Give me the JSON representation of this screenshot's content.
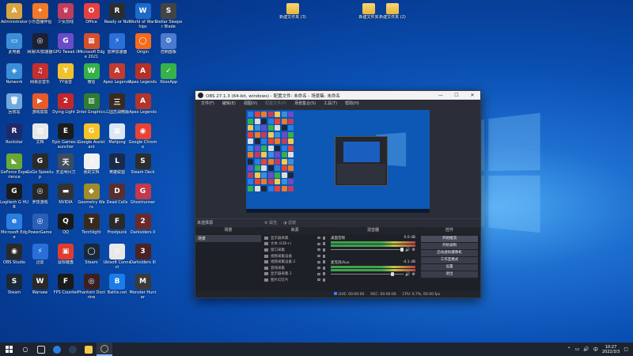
{
  "desktop": {
    "icons": [
      {
        "label": "Administrator",
        "col": 0,
        "row": 0,
        "color": "#d9a440",
        "glyph": "A"
      },
      {
        "label": "小乐直播伴侣",
        "col": 1,
        "row": 0,
        "color": "#f07a27",
        "glyph": "✦"
      },
      {
        "label": "少女前线",
        "col": 2,
        "row": 0,
        "color": "#c23c5b",
        "glyph": "♛"
      },
      {
        "label": "Office",
        "col": 3,
        "row": 0,
        "color": "#e8403f",
        "glyph": "O"
      },
      {
        "label": "Ready or Not",
        "col": 4,
        "row": 0,
        "color": "#2d2d2d",
        "glyph": "R"
      },
      {
        "label": "World of Warships",
        "col": 5,
        "row": 0,
        "color": "#1d6ac8",
        "glyph": "W"
      },
      {
        "label": "Stellar Sleeper Blade",
        "col": 6,
        "row": 0,
        "color": "#444",
        "glyph": "S"
      },
      {
        "label": "此电脑",
        "col": 0,
        "row": 1,
        "color": "#3b8fd9",
        "glyph": "▭"
      },
      {
        "label": "网易UU加速器",
        "col": 1,
        "row": 1,
        "color": "#1c2033",
        "glyph": "◎"
      },
      {
        "label": "GPU Tweak II",
        "col": 2,
        "row": 1,
        "color": "#6a4bc9",
        "glyph": "G"
      },
      {
        "label": "Microsoft Edge 2021",
        "col": 3,
        "row": 1,
        "color": "#d64e2c",
        "glyph": "▦"
      },
      {
        "label": "雷神加速器",
        "col": 4,
        "row": 1,
        "color": "#2b6fd8",
        "glyph": "⚡"
      },
      {
        "label": "Origin",
        "col": 5,
        "row": 1,
        "color": "#f56b1b",
        "glyph": "◯"
      },
      {
        "label": "控制面板",
        "col": 6,
        "row": 1,
        "color": "#4a7bd0",
        "glyph": "⚙"
      },
      {
        "label": "Network",
        "col": 0,
        "row": 2,
        "color": "#3b8fd9",
        "glyph": "◈"
      },
      {
        "label": "网易云音乐",
        "col": 1,
        "row": 2,
        "color": "#c62f2f",
        "glyph": "♫"
      },
      {
        "label": "YY语音",
        "col": 2,
        "row": 2,
        "color": "#f2c12e",
        "glyph": "Y"
      },
      {
        "label": "微信",
        "col": 3,
        "row": 2,
        "color": "#35b245",
        "glyph": "W"
      },
      {
        "label": "Apex Legends",
        "col": 4,
        "row": 2,
        "color": "#c23b2f",
        "glyph": "A"
      },
      {
        "label": "Apex Legends",
        "col": 5,
        "row": 2,
        "color": "#b53127",
        "glyph": "A"
      },
      {
        "label": "XboxApp",
        "col": 6,
        "row": 2,
        "color": "#36b24a",
        "glyph": "✓"
      },
      {
        "label": "回收站",
        "col": 0,
        "row": 3,
        "color": "#6fa8dc",
        "glyph": "🗑"
      },
      {
        "label": "游戏加加",
        "col": 1,
        "row": 3,
        "color": "#e75a2a",
        "glyph": "▶"
      },
      {
        "label": "Dying Light 2",
        "col": 2,
        "row": 3,
        "color": "#c4262e",
        "glyph": "2"
      },
      {
        "label": "Intel Graphics",
        "col": 3,
        "row": 3,
        "color": "#2e7d32",
        "glyph": "▥"
      },
      {
        "label": "三国志战略版",
        "col": 4,
        "row": 3,
        "color": "#3a2a1e",
        "glyph": "三"
      },
      {
        "label": "Apex Legends",
        "col": 5,
        "row": 3,
        "color": "#b2342a",
        "glyph": "A"
      },
      {
        "label": "Rockstar",
        "col": 0,
        "row": 4,
        "color": "#1f2a6b",
        "glyph": "R"
      },
      {
        "label": "文档",
        "col": 1,
        "row": 4,
        "color": "#e8e8e8",
        "glyph": "▤"
      },
      {
        "label": "Epic Games Launcher",
        "col": 2,
        "row": 4,
        "color": "#1b1b1b",
        "glyph": "E"
      },
      {
        "label": "Google Assistant",
        "col": 3,
        "row": 4,
        "color": "#f7c325",
        "glyph": "G"
      },
      {
        "label": "Mahjong",
        "col": 4,
        "row": 4,
        "color": "#dde6f2",
        "glyph": "▦"
      },
      {
        "label": "Google Chrome",
        "col": 5,
        "row": 4,
        "color": "#e94235",
        "glyph": "◉"
      },
      {
        "label": "GeForce Experience",
        "col": 0,
        "row": 5,
        "color": "#6aa836",
        "glyph": "◣"
      },
      {
        "label": "GoGo Speedup",
        "col": 1,
        "row": 5,
        "color": "#2a2a2a",
        "glyph": "G"
      },
      {
        "label": "天涯明月刀",
        "col": 2,
        "row": 5,
        "color": "#3e4c5e",
        "glyph": "天"
      },
      {
        "label": "我的文档",
        "col": 3,
        "row": 5,
        "color": "#f2f2f2",
        "glyph": "▯"
      },
      {
        "label": "英雄联盟",
        "col": 4,
        "row": 5,
        "color": "#1c2a4a",
        "glyph": "L"
      },
      {
        "label": "Steam Deck",
        "col": 5,
        "row": 5,
        "color": "#2d2d2d",
        "glyph": "S"
      },
      {
        "label": "Logitech G HUB",
        "col": 0,
        "row": 6,
        "color": "#1b1b1b",
        "glyph": "G"
      },
      {
        "label": "罗技游戏",
        "col": 1,
        "row": 6,
        "color": "#262626",
        "glyph": "◎"
      },
      {
        "label": "NVIDIA",
        "col": 2,
        "row": 6,
        "color": "#333",
        "glyph": "▬"
      },
      {
        "label": "Geometry Wars",
        "col": 3,
        "row": 6,
        "color": "#a08d2a",
        "glyph": "◆"
      },
      {
        "label": "Dead Cells",
        "col": 4,
        "row": 6,
        "color": "#5a2e2e",
        "glyph": "D"
      },
      {
        "label": "Ghostrunner",
        "col": 5,
        "row": 6,
        "color": "#c2394a",
        "glyph": "G"
      },
      {
        "label": "Microsoft Edge",
        "col": 0,
        "row": 7,
        "color": "#2a7de1",
        "glyph": "e"
      },
      {
        "label": "PowerGame",
        "col": 1,
        "row": 7,
        "color": "#2a5fb8",
        "glyph": "◎"
      },
      {
        "label": "QQ",
        "col": 2,
        "row": 7,
        "color": "#1a1a1a",
        "glyph": "Q"
      },
      {
        "label": "Torchlight",
        "col": 3,
        "row": 7,
        "color": "#3a2a1e",
        "glyph": "T"
      },
      {
        "label": "Frostpunk",
        "col": 4,
        "row": 7,
        "color": "#2a2a2a",
        "glyph": "F"
      },
      {
        "label": "Darksiders II",
        "col": 5,
        "row": 7,
        "color": "#6a2a2a",
        "glyph": "2"
      },
      {
        "label": "OBS Studio",
        "col": 0,
        "row": 8,
        "color": "#2a2a2a",
        "glyph": "◉"
      },
      {
        "label": "迅雷",
        "col": 1,
        "row": 8,
        "color": "#2a6fd8",
        "glyph": "⚡"
      },
      {
        "label": "鼠标键盘",
        "col": 2,
        "row": 8,
        "color": "#e03c2f",
        "glyph": "▣"
      },
      {
        "label": "Steam",
        "col": 3,
        "row": 8,
        "color": "#1b2838",
        "glyph": "◯"
      },
      {
        "label": "Ubisoft Connect",
        "col": 4,
        "row": 8,
        "color": "#e8e8e8",
        "glyph": "◎"
      },
      {
        "label": "Darksiders III",
        "col": 5,
        "row": 8,
        "color": "#4a2222",
        "glyph": "3"
      },
      {
        "label": "Steam",
        "col": 0,
        "row": 9,
        "color": "#1b2838",
        "glyph": "S"
      },
      {
        "label": "Warsaw",
        "col": 1,
        "row": 9,
        "color": "#2a2a2a",
        "glyph": "W"
      },
      {
        "label": "FPS Counter",
        "col": 2,
        "row": 9,
        "color": "#1a1a1a",
        "glyph": "F"
      },
      {
        "label": "Phantom Doctrine",
        "col": 3,
        "row": 9,
        "color": "#3a2020",
        "glyph": "◎"
      },
      {
        "label": "Battle.net",
        "col": 4,
        "row": 9,
        "color": "#1c7de8",
        "glyph": "B"
      },
      {
        "label": "Monster Hunter",
        "col": 5,
        "row": 9,
        "color": "#3a3a3a",
        "glyph": "M"
      }
    ],
    "folders": [
      {
        "label": "新建文件夹 (3)"
      },
      {
        "label": "新建文件夹"
      },
      {
        "label": "新建文件夹 (2)"
      }
    ]
  },
  "obs": {
    "title": "OBS 27.1.3 (64-bit, windows) - 配置文件: 未命名 - 场景集: 未命名",
    "window_buttons": {
      "minimize": "—",
      "maximize": "☐",
      "close": "✕"
    },
    "menu": [
      "文件(F)",
      "编辑(E)",
      "视图(V)",
      "配置文件(P)",
      "场景集合(S)",
      "工具(T)",
      "帮助(H)"
    ],
    "no_source": "未选择源",
    "props_button": "属性",
    "filters_button": "滤镜",
    "docks": {
      "scenes": {
        "title": "场景",
        "items": [
          "场景"
        ]
      },
      "sources": {
        "title": "来源",
        "items": [
          "显示器采集",
          "文本 (GDI+)",
          "窗口采集",
          "视频采集设备",
          "视频采集设备 2",
          "游戏采集",
          "显示器采集 2",
          "图片幻灯片"
        ]
      },
      "mixer": {
        "title": "混音器",
        "channels": [
          {
            "name": "桌面音频",
            "db": "0.0 dB"
          },
          {
            "name": "麦克风/Aux",
            "db": "-4.1 dB"
          }
        ]
      },
      "controls": {
        "title": "控件",
        "buttons": [
          "开始推流",
          "开始录制",
          "启动虚拟摄像机",
          "工作室模式",
          "设置",
          "退出"
        ],
        "tabs": [
          "控件",
          "场景转换"
        ]
      }
    },
    "status": {
      "live_label": "LIVE:",
      "live_time": "00:00:00",
      "rec_label": "REC:",
      "rec_time": "00:00:00",
      "cpu": "CPU: 0.7%, 60.00 fps"
    }
  },
  "taskbar": {
    "apps": [
      "Windows 资源管理器",
      "Microsoft Edge",
      "Steam",
      "OBS Studio",
      "任务视图",
      "文件资源管理器"
    ],
    "time": "10:27",
    "date": "2022/3/3",
    "ime": "中"
  }
}
